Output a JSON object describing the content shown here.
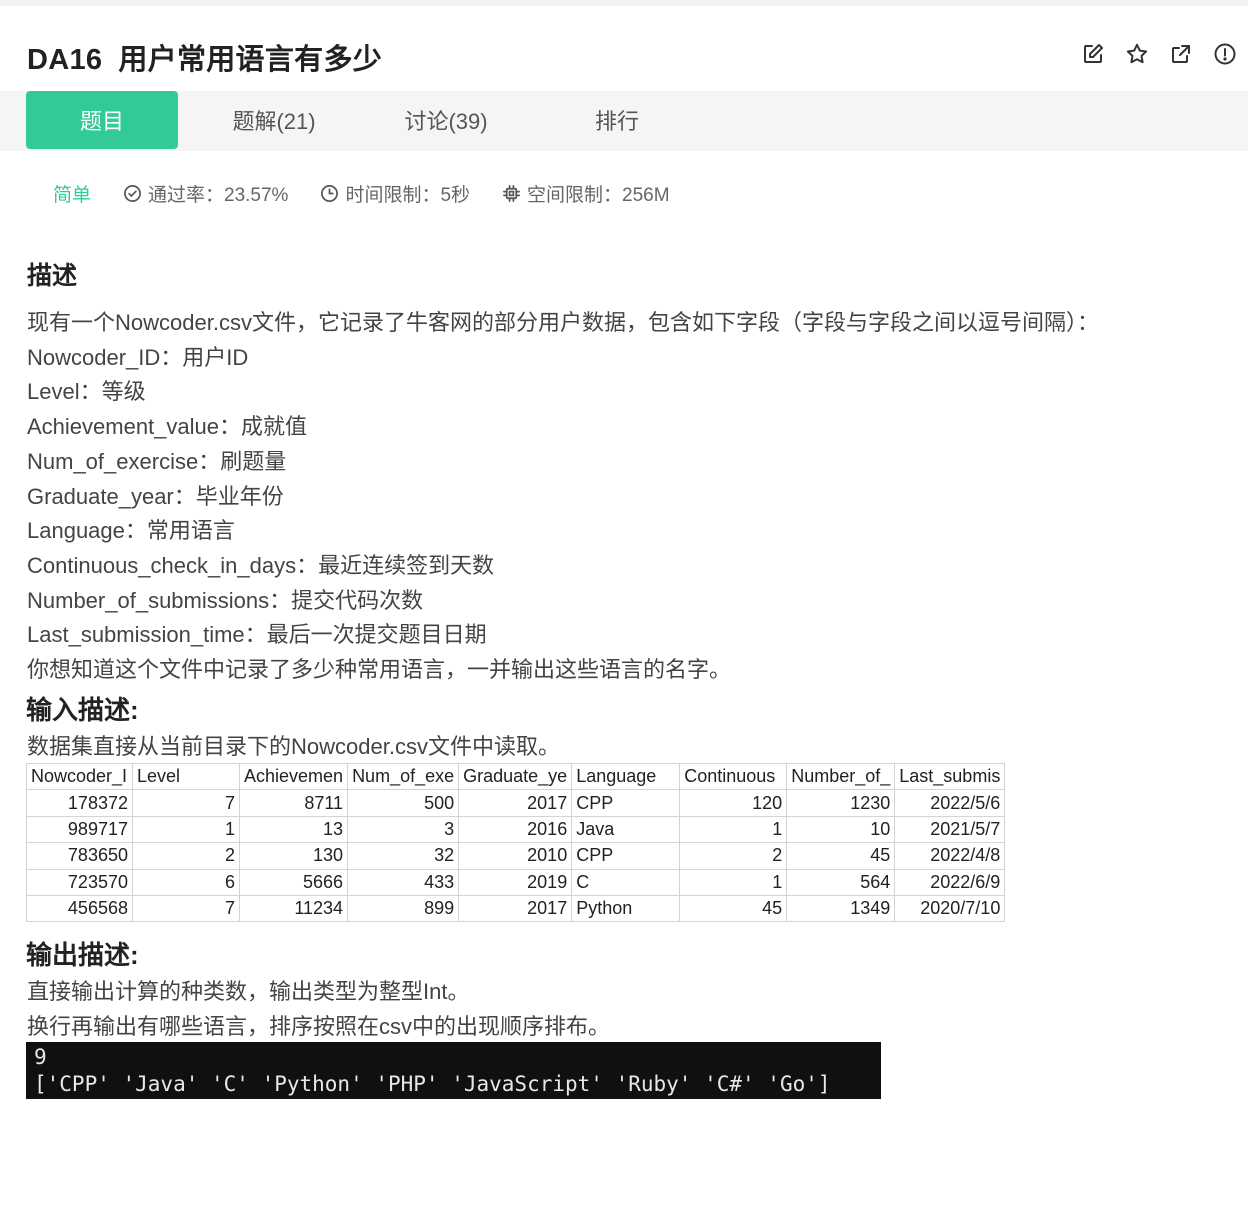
{
  "problem": {
    "code": "DA16",
    "title": "用户常用语言有多少"
  },
  "actions": [
    {
      "name": "edit-icon"
    },
    {
      "name": "star-icon"
    },
    {
      "name": "share-icon"
    },
    {
      "name": "report-icon"
    }
  ],
  "tabs": [
    {
      "label": "题目",
      "active": true
    },
    {
      "label": "题解(21)"
    },
    {
      "label": "讨论(39)"
    },
    {
      "label": "排行"
    }
  ],
  "meta": {
    "difficulty": "简单",
    "pass_rate": "通过率：23.57%",
    "time_limit": "时间限制：5秒",
    "memory_limit": "空间限制：256M"
  },
  "description": {
    "heading": "描述",
    "lines": [
      "现有一个Nowcoder.csv文件，它记录了牛客网的部分用户数据，包含如下字段（字段与字段之间以逗号间隔）：",
      "Nowcoder_ID：用户ID",
      "Level：等级",
      "Achievement_value：成就值",
      "Num_of_exercise：刷题量",
      "Graduate_year：毕业年份",
      "Language：常用语言",
      "Continuous_check_in_days：最近连续签到天数",
      "Number_of_submissions：提交代码次数",
      "Last_submission_time：最后一次提交题目日期",
      "你想知道这个文件中记录了多少种常用语言，一并输出这些语言的名字。"
    ]
  },
  "input": {
    "heading": "输入描述:",
    "text": "数据集直接从当前目录下的Nowcoder.csv文件中读取。",
    "table": {
      "headers": [
        "Nowcoder_I",
        "Level",
        "Achievemen",
        "Num_of_exe",
        "Graduate_ye",
        "Language",
        "Continuous",
        "Number_of_",
        "Last_submis"
      ],
      "rows": [
        [
          "178372",
          "7",
          "8711",
          "500",
          "2017",
          "CPP",
          "120",
          "1230",
          "2022/5/6"
        ],
        [
          "989717",
          "1",
          "13",
          "3",
          "2016",
          "Java",
          "1",
          "10",
          "2021/5/7"
        ],
        [
          "783650",
          "2",
          "130",
          "32",
          "2010",
          "CPP",
          "2",
          "45",
          "2022/4/8"
        ],
        [
          "723570",
          "6",
          "5666",
          "433",
          "2019",
          "C",
          "1",
          "564",
          "2022/6/9"
        ],
        [
          "456568",
          "7",
          "11234",
          "899",
          "2017",
          "Python",
          "45",
          "1349",
          "2020/7/10"
        ]
      ]
    }
  },
  "output": {
    "heading": "输出描述:",
    "line1": "直接输出计算的种类数，输出类型为整型Int。",
    "line2": "换行再输出有哪些语言，排序按照在csv中的出现顺序排布。",
    "terminal": {
      "line1": "9",
      "line2": "['CPP' 'Java' 'C' 'Python' 'PHP' 'JavaScript' 'Ruby' 'C#' 'Go']"
    }
  },
  "colors": {
    "accent": "#32ca99",
    "tab_bar": "#f5f5f7",
    "terminal_bg": "#101010"
  }
}
